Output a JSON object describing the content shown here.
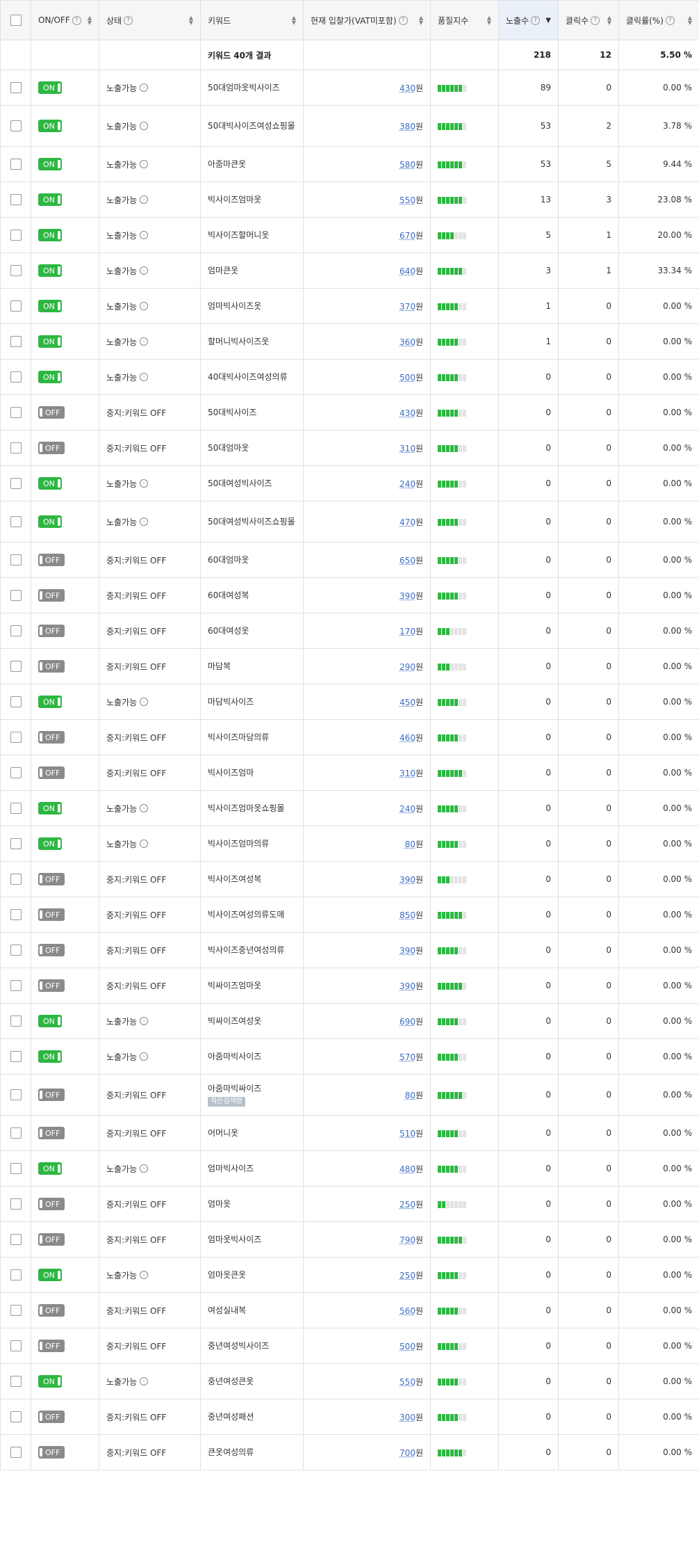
{
  "headers": {
    "onoff": "ON/OFF",
    "status": "상태",
    "keyword": "키워드",
    "bid": "현재 입찰가(VAT미포함)",
    "quality": "품질지수",
    "impressions": "노출수",
    "clicks": "클릭수",
    "ctr": "클릭률(%)"
  },
  "summary": {
    "label": "키워드 40개 결과",
    "impressions": "218",
    "clicks": "12",
    "ctr": "5.50 %"
  },
  "currency_unit": "원",
  "toggle_labels": {
    "on": "ON",
    "off": "OFF"
  },
  "colors": {
    "on": "#2db742",
    "off": "#8a8a8a",
    "link": "#3d6bc7"
  },
  "rows": [
    {
      "on": true,
      "status": "노출가능",
      "keyword": "50대엄마옷빅사이즈",
      "bid": "430",
      "quality": 6,
      "impressions": "89",
      "clicks": "0",
      "ctr": "0.00 %"
    },
    {
      "on": true,
      "status": "노출가능",
      "keyword": "50대빅사이즈여성쇼핑몰",
      "bid": "380",
      "quality": 6,
      "impressions": "53",
      "clicks": "2",
      "ctr": "3.78 %"
    },
    {
      "on": true,
      "status": "노출가능",
      "keyword": "아줌마큰옷",
      "bid": "580",
      "quality": 6,
      "impressions": "53",
      "clicks": "5",
      "ctr": "9.44 %"
    },
    {
      "on": true,
      "status": "노출가능",
      "keyword": "빅사이즈엄마옷",
      "bid": "550",
      "quality": 6,
      "impressions": "13",
      "clicks": "3",
      "ctr": "23.08 %"
    },
    {
      "on": true,
      "status": "노출가능",
      "keyword": "빅사이즈할머니옷",
      "bid": "670",
      "quality": 4,
      "impressions": "5",
      "clicks": "1",
      "ctr": "20.00 %"
    },
    {
      "on": true,
      "status": "노출가능",
      "keyword": "엄마큰옷",
      "bid": "640",
      "quality": 6,
      "impressions": "3",
      "clicks": "1",
      "ctr": "33.34 %"
    },
    {
      "on": true,
      "status": "노출가능",
      "keyword": "엄마빅사이즈옷",
      "bid": "370",
      "quality": 5,
      "impressions": "1",
      "clicks": "0",
      "ctr": "0.00 %"
    },
    {
      "on": true,
      "status": "노출가능",
      "keyword": "할머니빅사이즈옷",
      "bid": "360",
      "quality": 5,
      "impressions": "1",
      "clicks": "0",
      "ctr": "0.00 %"
    },
    {
      "on": true,
      "status": "노출가능",
      "keyword": "40대빅사이즈여성의류",
      "bid": "500",
      "quality": 5,
      "impressions": "0",
      "clicks": "0",
      "ctr": "0.00 %"
    },
    {
      "on": false,
      "status": "중지:키워드 OFF",
      "keyword": "50대빅사이즈",
      "bid": "430",
      "quality": 5,
      "impressions": "0",
      "clicks": "0",
      "ctr": "0.00 %"
    },
    {
      "on": false,
      "status": "중지:키워드 OFF",
      "keyword": "50대엄마옷",
      "bid": "310",
      "quality": 5,
      "impressions": "0",
      "clicks": "0",
      "ctr": "0.00 %"
    },
    {
      "on": true,
      "status": "노출가능",
      "keyword": "50대여성빅사이즈",
      "bid": "240",
      "quality": 5,
      "impressions": "0",
      "clicks": "0",
      "ctr": "0.00 %"
    },
    {
      "on": true,
      "status": "노출가능",
      "keyword": "50대여성빅사이즈쇼핑몰",
      "bid": "470",
      "quality": 5,
      "impressions": "0",
      "clicks": "0",
      "ctr": "0.00 %"
    },
    {
      "on": false,
      "status": "중지:키워드 OFF",
      "keyword": "60대엄마옷",
      "bid": "650",
      "quality": 5,
      "impressions": "0",
      "clicks": "0",
      "ctr": "0.00 %"
    },
    {
      "on": false,
      "status": "중지:키워드 OFF",
      "keyword": "60대여성복",
      "bid": "390",
      "quality": 5,
      "impressions": "0",
      "clicks": "0",
      "ctr": "0.00 %"
    },
    {
      "on": false,
      "status": "중지:키워드 OFF",
      "keyword": "60대여성옷",
      "bid": "170",
      "quality": 3,
      "impressions": "0",
      "clicks": "0",
      "ctr": "0.00 %"
    },
    {
      "on": false,
      "status": "중지:키워드 OFF",
      "keyword": "마담복",
      "bid": "290",
      "quality": 3,
      "impressions": "0",
      "clicks": "0",
      "ctr": "0.00 %"
    },
    {
      "on": true,
      "status": "노출가능",
      "keyword": "마담빅사이즈",
      "bid": "450",
      "quality": 5,
      "impressions": "0",
      "clicks": "0",
      "ctr": "0.00 %"
    },
    {
      "on": false,
      "status": "중지:키워드 OFF",
      "keyword": "빅사이즈마담의류",
      "bid": "460",
      "quality": 5,
      "impressions": "0",
      "clicks": "0",
      "ctr": "0.00 %"
    },
    {
      "on": false,
      "status": "중지:키워드 OFF",
      "keyword": "빅사이즈엄마",
      "bid": "310",
      "quality": 6,
      "impressions": "0",
      "clicks": "0",
      "ctr": "0.00 %"
    },
    {
      "on": true,
      "status": "노출가능",
      "keyword": "빅사이즈엄마옷쇼핑몰",
      "bid": "240",
      "quality": 5,
      "impressions": "0",
      "clicks": "0",
      "ctr": "0.00 %"
    },
    {
      "on": true,
      "status": "노출가능",
      "keyword": "빅사이즈엄마의류",
      "bid": "80",
      "quality": 5,
      "impressions": "0",
      "clicks": "0",
      "ctr": "0.00 %"
    },
    {
      "on": false,
      "status": "중지:키워드 OFF",
      "keyword": "빅사이즈여성복",
      "bid": "390",
      "quality": 3,
      "impressions": "0",
      "clicks": "0",
      "ctr": "0.00 %"
    },
    {
      "on": false,
      "status": "중지:키워드 OFF",
      "keyword": "빅사이즈여성의류도매",
      "bid": "850",
      "quality": 6,
      "impressions": "0",
      "clicks": "0",
      "ctr": "0.00 %"
    },
    {
      "on": false,
      "status": "중지:키워드 OFF",
      "keyword": "빅사이즈중년여성의류",
      "bid": "390",
      "quality": 5,
      "impressions": "0",
      "clicks": "0",
      "ctr": "0.00 %"
    },
    {
      "on": false,
      "status": "중지:키워드 OFF",
      "keyword": "빅싸이즈엄마옷",
      "bid": "390",
      "quality": 6,
      "impressions": "0",
      "clicks": "0",
      "ctr": "0.00 %"
    },
    {
      "on": true,
      "status": "노출가능",
      "keyword": "빅싸이즈여성옷",
      "bid": "690",
      "quality": 5,
      "impressions": "0",
      "clicks": "0",
      "ctr": "0.00 %"
    },
    {
      "on": true,
      "status": "노출가능",
      "keyword": "아줌마빅사이즈",
      "bid": "570",
      "quality": 5,
      "impressions": "0",
      "clicks": "0",
      "ctr": "0.00 %"
    },
    {
      "on": false,
      "status": "중지:키워드 OFF",
      "keyword": "아줌마빅싸이즈",
      "badge": "적은검색량",
      "bid": "80",
      "quality": 6,
      "impressions": "0",
      "clicks": "0",
      "ctr": "0.00 %"
    },
    {
      "on": false,
      "status": "중지:키워드 OFF",
      "keyword": "어머니옷",
      "bid": "510",
      "quality": 5,
      "impressions": "0",
      "clicks": "0",
      "ctr": "0.00 %"
    },
    {
      "on": true,
      "status": "노출가능",
      "keyword": "엄마빅사이즈",
      "bid": "480",
      "quality": 5,
      "impressions": "0",
      "clicks": "0",
      "ctr": "0.00 %"
    },
    {
      "on": false,
      "status": "중지:키워드 OFF",
      "keyword": "엄마옷",
      "bid": "250",
      "quality": 2,
      "impressions": "0",
      "clicks": "0",
      "ctr": "0.00 %"
    },
    {
      "on": false,
      "status": "중지:키워드 OFF",
      "keyword": "엄마옷빅사이즈",
      "bid": "790",
      "quality": 6,
      "impressions": "0",
      "clicks": "0",
      "ctr": "0.00 %"
    },
    {
      "on": true,
      "status": "노출가능",
      "keyword": "엄마옷큰옷",
      "bid": "250",
      "quality": 5,
      "impressions": "0",
      "clicks": "0",
      "ctr": "0.00 %"
    },
    {
      "on": false,
      "status": "중지:키워드 OFF",
      "keyword": "여성실내복",
      "bid": "560",
      "quality": 5,
      "impressions": "0",
      "clicks": "0",
      "ctr": "0.00 %"
    },
    {
      "on": false,
      "status": "중지:키워드 OFF",
      "keyword": "중년여성빅사이즈",
      "bid": "500",
      "quality": 5,
      "impressions": "0",
      "clicks": "0",
      "ctr": "0.00 %"
    },
    {
      "on": true,
      "status": "노출가능",
      "keyword": "중년여성큰옷",
      "bid": "550",
      "quality": 5,
      "impressions": "0",
      "clicks": "0",
      "ctr": "0.00 %"
    },
    {
      "on": false,
      "status": "중지:키워드 OFF",
      "keyword": "중년여성패션",
      "bid": "300",
      "quality": 5,
      "impressions": "0",
      "clicks": "0",
      "ctr": "0.00 %"
    },
    {
      "on": false,
      "status": "중지:키워드 OFF",
      "keyword": "큰옷여성의류",
      "bid": "700",
      "quality": 6,
      "impressions": "0",
      "clicks": "0",
      "ctr": "0.00 %"
    }
  ]
}
